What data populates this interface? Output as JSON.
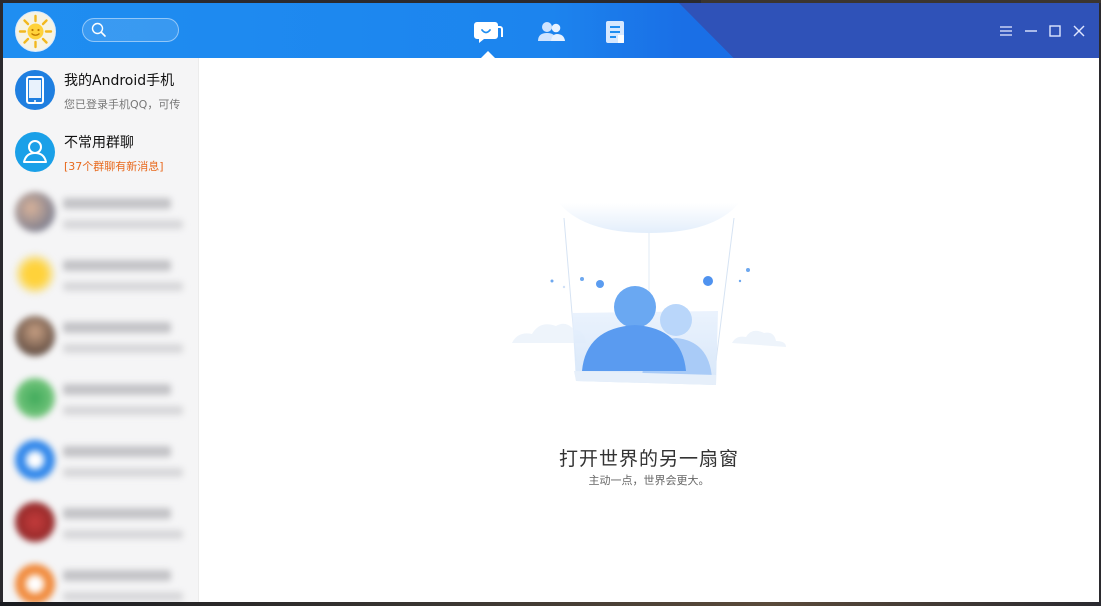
{
  "titlebar": {
    "search_placeholder": "",
    "tabs": [
      {
        "id": "messages",
        "icon": "chat-bubble-icon",
        "active": true
      },
      {
        "id": "contacts",
        "icon": "contacts-icon",
        "active": false
      },
      {
        "id": "apps",
        "icon": "document-icon",
        "active": false
      }
    ],
    "window_controls": [
      "menu-icon",
      "minimize-icon",
      "maximize-icon",
      "close-icon"
    ]
  },
  "sidebar": {
    "items": [
      {
        "name": "我的Android手机",
        "subtitle": "您已登录手机QQ，可传",
        "icon": "phone-icon",
        "color": "#1f7fe0"
      },
      {
        "name": "不常用群聊",
        "subtitle": "[37个群聊有新消息]",
        "icon": "group-chat-icon",
        "color": "#1aa0e8",
        "subtitle_color": "#e8691d"
      }
    ]
  },
  "main": {
    "heading": "打开世界的另一扇窗",
    "tagline": "主动一点，世界会更大。"
  },
  "colors": {
    "titlebar_blue": "#1f8ef1",
    "titlebar_dark": "#2f52b8"
  }
}
